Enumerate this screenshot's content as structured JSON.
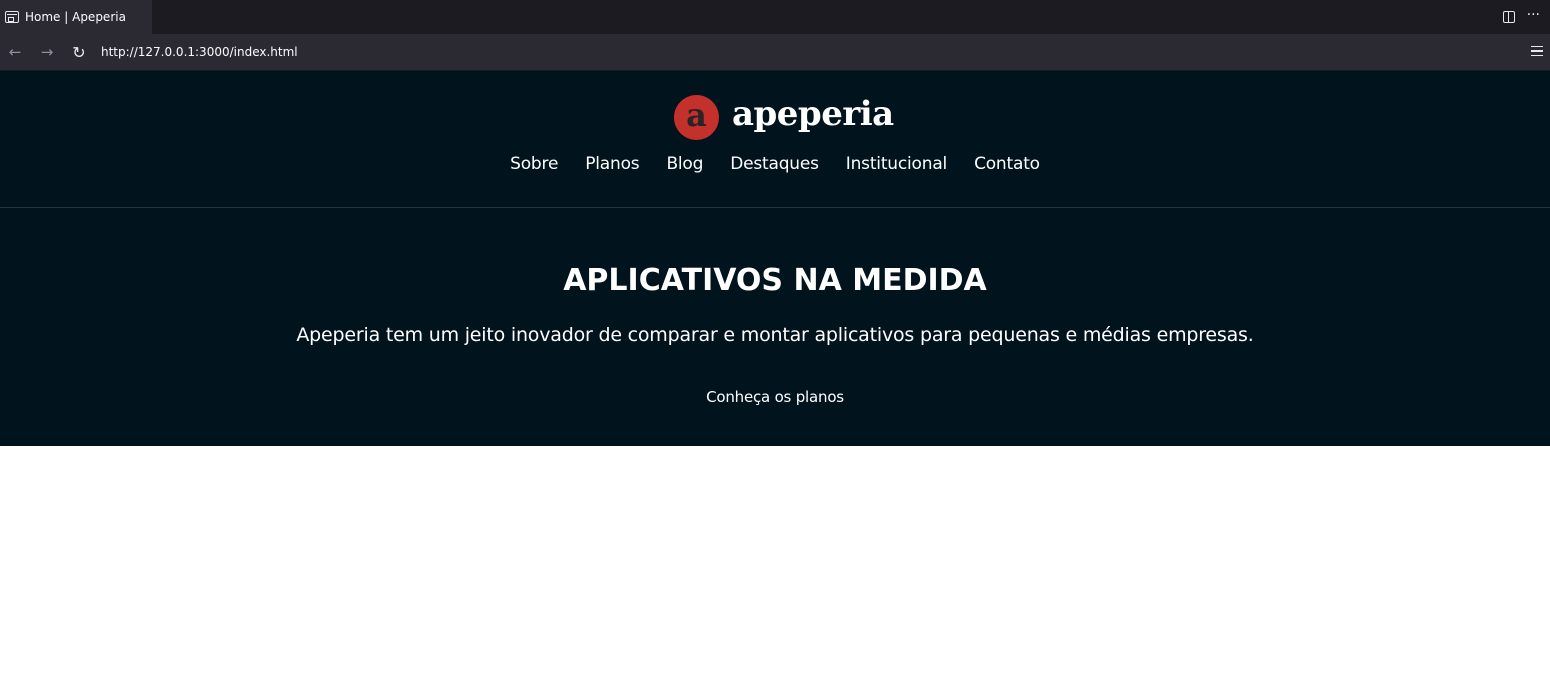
{
  "browser": {
    "tab_title": "Home | Apeperia",
    "url": "http://127.0.0.1:3000/index.html",
    "icons": {
      "tab": "page-icon",
      "split": "split-view-icon",
      "more": "more-options-icon",
      "back": "back-arrow-icon",
      "forward": "forward-arrow-icon",
      "reload": "reload-icon",
      "menu": "hamburger-menu-icon"
    },
    "glyphs": {
      "more": "···",
      "back": "←",
      "forward": "→",
      "reload": "↻"
    }
  },
  "site": {
    "colors": {
      "background": "#01141d",
      "logo": "#c4302b",
      "text": "#ffffff"
    },
    "brand": {
      "logo_letter": "a",
      "name": "apeperia"
    },
    "nav": [
      "Sobre",
      "Planos",
      "Blog",
      "Destaques",
      "Institucional",
      "Contato"
    ],
    "hero": {
      "title": "APLICATIVOS NA MEDIDA",
      "text": "Apeperia tem um jeito inovador de comparar e montar aplicativos para pequenas e médias empresas.",
      "cta": "Conheça os planos"
    }
  }
}
